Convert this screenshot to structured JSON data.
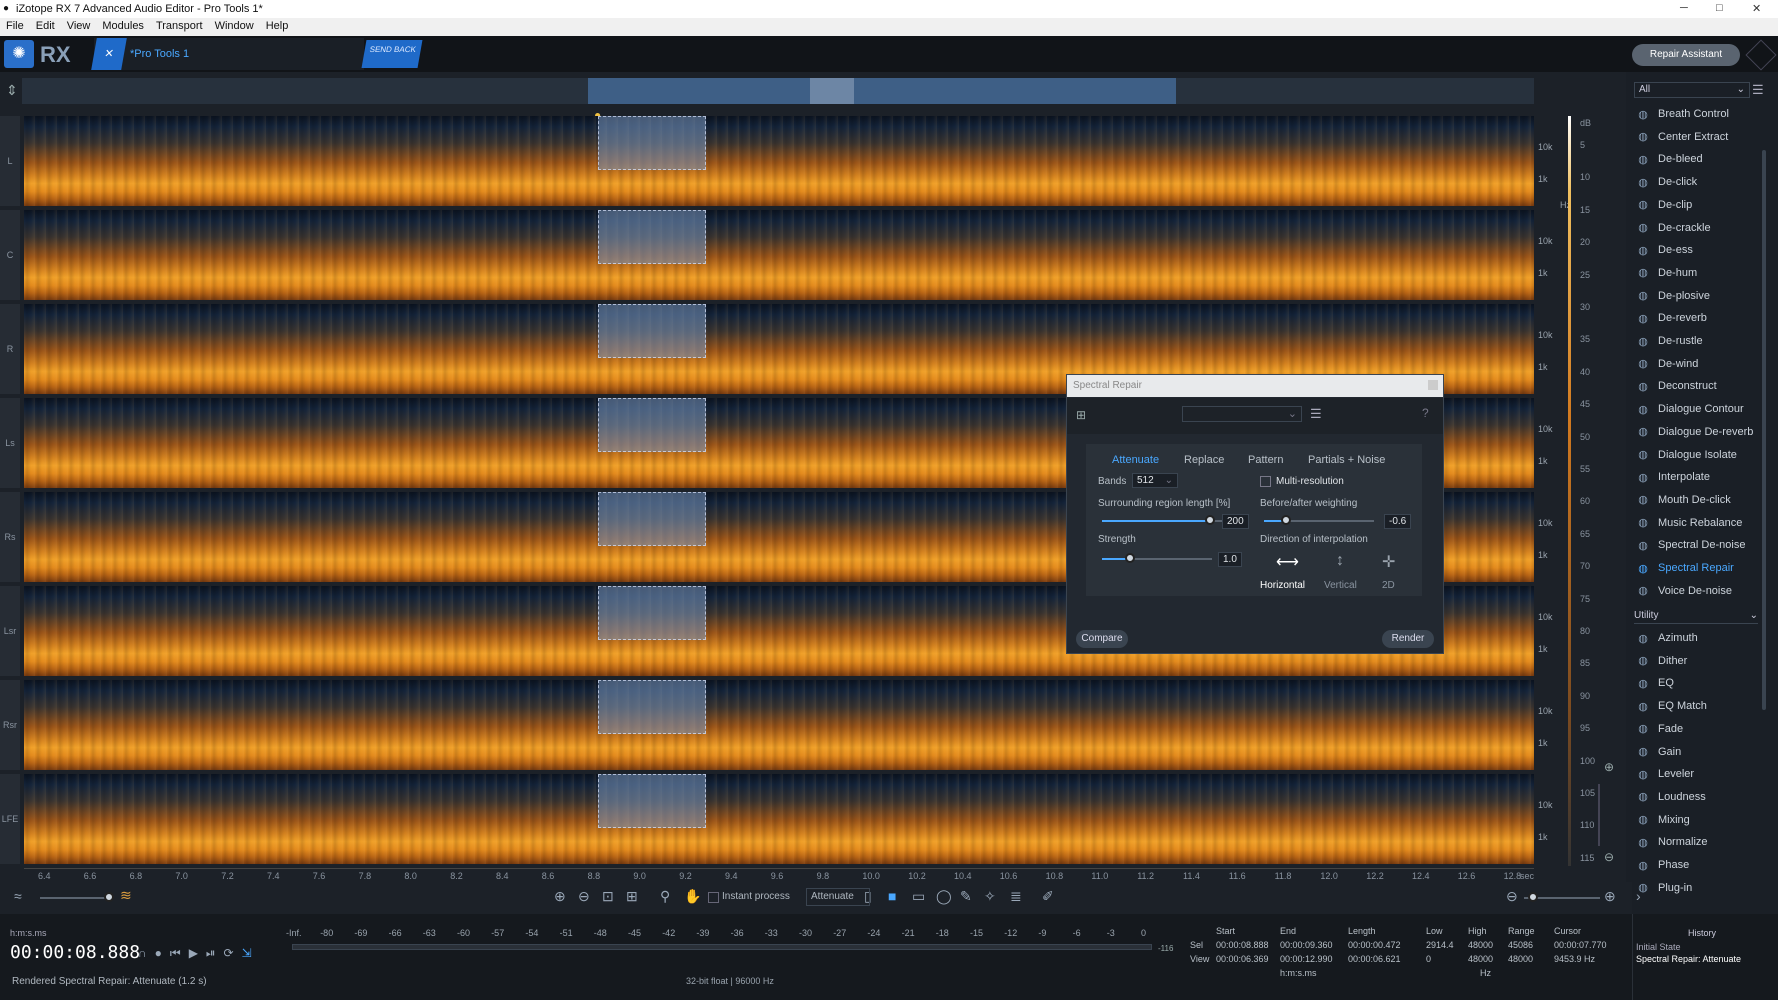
{
  "window": {
    "title": "iZotope RX 7 Advanced Audio Editor - Pro Tools 1*"
  },
  "menu": [
    "File",
    "Edit",
    "View",
    "Modules",
    "Transport",
    "Window",
    "Help"
  ],
  "app": {
    "logo": "RX",
    "file_tab": "*Pro Tools 1",
    "send_back": "SEND BACK",
    "repair_assistant": "Repair Assistant"
  },
  "channels": [
    "L",
    "C",
    "R",
    "Ls",
    "Rs",
    "Lsr",
    "Rsr",
    "LFE"
  ],
  "freq_labels": {
    "hi": "10k",
    "lo": "1k",
    "unit": "Hz"
  },
  "db_scale": {
    "unit": "dB",
    "ticks": [
      "5",
      "10",
      "15",
      "20",
      "25",
      "30",
      "35",
      "40",
      "45",
      "50",
      "55",
      "60",
      "65",
      "70",
      "75",
      "80",
      "85",
      "90",
      "95",
      "100",
      "105",
      "110",
      "115"
    ]
  },
  "time_axis": {
    "ticks": [
      "6.4",
      "6.6",
      "6.8",
      "7.0",
      "7.2",
      "7.4",
      "7.6",
      "7.8",
      "8.0",
      "8.2",
      "8.4",
      "8.6",
      "8.8",
      "9.0",
      "9.2",
      "9.4",
      "9.6",
      "9.8",
      "10.0",
      "10.2",
      "10.4",
      "10.6",
      "10.8",
      "11.0",
      "11.2",
      "11.4",
      "11.6",
      "11.8",
      "12.0",
      "12.2",
      "12.4",
      "12.6",
      "12.8"
    ],
    "unit": "sec"
  },
  "toolbar": {
    "instant_process": "Instant process",
    "mode": "Attenuate"
  },
  "transport": {
    "format_label": "h:m:s.ms",
    "timecode": "00:00:08.888",
    "status": "Rendered Spectral Repair: Attenuate (1.2 s)"
  },
  "meter": {
    "ticks": [
      "-Inf.",
      "-80",
      "-69",
      "-66",
      "-63",
      "-60",
      "-57",
      "-54",
      "-51",
      "-48",
      "-45",
      "-42",
      "-39",
      "-36",
      "-33",
      "-30",
      "-27",
      "-24",
      "-21",
      "-18",
      "-15",
      "-12",
      "-9",
      "-6",
      "-3",
      "0"
    ],
    "peak": "-116",
    "format": "32-bit float | 96000 Hz"
  },
  "info": {
    "headers": [
      "Start",
      "End",
      "Length",
      "Low",
      "High",
      "Range",
      "Cursor"
    ],
    "sel_label": "Sel",
    "view_label": "View",
    "sel": [
      "00:00:08.888",
      "00:00:09.360",
      "00:00:00.472",
      "2914.4",
      "48000",
      "45086",
      "00:00:07.770"
    ],
    "view": [
      "00:00:06.369",
      "00:00:12.990",
      "00:00:06.621",
      "0",
      "48000",
      "48000",
      "9453.9 Hz"
    ],
    "time_unit": "h:m:s.ms",
    "freq_unit": "Hz"
  },
  "history": {
    "title": "History",
    "initial": "Initial State",
    "last": "Spectral Repair: Attenuate"
  },
  "modules": {
    "filter": "All",
    "repair": [
      {
        "label": "Breath Control",
        "icon": "breath-icon"
      },
      {
        "label": "Center Extract",
        "icon": "center-extract-icon"
      },
      {
        "label": "De-bleed",
        "icon": "de-bleed-icon"
      },
      {
        "label": "De-click",
        "icon": "de-click-icon"
      },
      {
        "label": "De-clip",
        "icon": "de-clip-icon"
      },
      {
        "label": "De-crackle",
        "icon": "de-crackle-icon"
      },
      {
        "label": "De-ess",
        "icon": "de-ess-icon"
      },
      {
        "label": "De-hum",
        "icon": "de-hum-icon"
      },
      {
        "label": "De-plosive",
        "icon": "de-plosive-icon"
      },
      {
        "label": "De-reverb",
        "icon": "de-reverb-icon"
      },
      {
        "label": "De-rustle",
        "icon": "de-rustle-icon"
      },
      {
        "label": "De-wind",
        "icon": "de-wind-icon"
      },
      {
        "label": "Deconstruct",
        "icon": "deconstruct-icon"
      },
      {
        "label": "Dialogue Contour",
        "icon": "dialogue-contour-icon"
      },
      {
        "label": "Dialogue De-reverb",
        "icon": "dialogue-de-reverb-icon"
      },
      {
        "label": "Dialogue Isolate",
        "icon": "dialogue-isolate-icon"
      },
      {
        "label": "Interpolate",
        "icon": "interpolate-icon"
      },
      {
        "label": "Mouth De-click",
        "icon": "mouth-de-click-icon"
      },
      {
        "label": "Music Rebalance",
        "icon": "music-rebalance-icon"
      },
      {
        "label": "Spectral De-noise",
        "icon": "spectral-de-noise-icon"
      },
      {
        "label": "Spectral Repair",
        "icon": "spectral-repair-icon",
        "active": true
      },
      {
        "label": "Voice De-noise",
        "icon": "voice-de-noise-icon"
      }
    ],
    "utility_label": "Utility",
    "utility": [
      {
        "label": "Azimuth",
        "icon": "azimuth-icon"
      },
      {
        "label": "Dither",
        "icon": "dither-icon"
      },
      {
        "label": "EQ",
        "icon": "eq-icon"
      },
      {
        "label": "EQ Match",
        "icon": "eq-match-icon"
      },
      {
        "label": "Fade",
        "icon": "fade-icon"
      },
      {
        "label": "Gain",
        "icon": "gain-icon"
      },
      {
        "label": "Leveler",
        "icon": "leveler-icon"
      },
      {
        "label": "Loudness",
        "icon": "loudness-icon"
      },
      {
        "label": "Mixing",
        "icon": "mixing-icon"
      },
      {
        "label": "Normalize",
        "icon": "normalize-icon"
      },
      {
        "label": "Phase",
        "icon": "phase-icon"
      },
      {
        "label": "Plug-in",
        "icon": "plug-in-icon"
      }
    ]
  },
  "dialog": {
    "title": "Spectral Repair",
    "tabs": [
      "Attenuate",
      "Replace",
      "Pattern",
      "Partials + Noise"
    ],
    "active_tab": "Attenuate",
    "bands_label": "Bands",
    "bands": "512",
    "multi_resolution": "Multi-resolution",
    "multi_resolution_checked": false,
    "surrounding_label": "Surrounding region length [%]",
    "surrounding": "200",
    "surrounding_pct": 0.9,
    "weighting_label": "Before/after weighting",
    "weighting": "-0.6",
    "weighting_pct": 0.2,
    "strength_label": "Strength",
    "strength": "1.0",
    "strength_pct": 0.25,
    "direction_label": "Direction of interpolation",
    "directions": [
      "Horizontal",
      "Vertical",
      "2D"
    ],
    "active_direction": "Horizontal",
    "compare": "Compare",
    "render": "Render",
    "help": "?"
  }
}
